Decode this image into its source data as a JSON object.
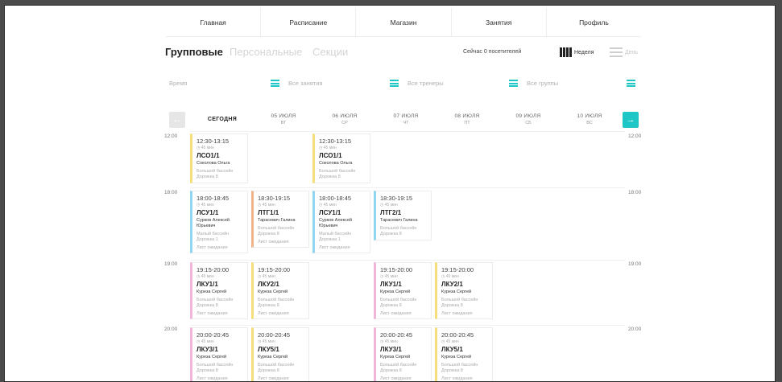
{
  "nav": [
    "Главная",
    "Расписание",
    "Магазин",
    "Занятия",
    "Профиль"
  ],
  "tabs": {
    "group": "Групповые",
    "personal": "Персональные",
    "sections": "Секции"
  },
  "visitors": "Сейчас 0 посетителей",
  "view": {
    "week": "Неделя",
    "day": "День"
  },
  "filters": [
    {
      "placeholder": "Время"
    },
    {
      "placeholder": "Все занятия"
    },
    {
      "placeholder": "Все тренеры"
    },
    {
      "placeholder": "Все группы"
    }
  ],
  "arrows": {
    "prev": "←",
    "next": "→"
  },
  "days": [
    {
      "d1": "СЕГОДНЯ",
      "d2": ""
    },
    {
      "d1": "05 ИЮЛЯ",
      "d2": "ВТ"
    },
    {
      "d1": "06 ИЮЛЯ",
      "d2": "СР"
    },
    {
      "d1": "07 ИЮЛЯ",
      "d2": "ЧТ"
    },
    {
      "d1": "08 ИЮЛЯ",
      "d2": "ПТ"
    },
    {
      "d1": "09 ИЮЛЯ",
      "d2": "СБ"
    },
    {
      "d1": "10 ИЮЛЯ",
      "d2": "ВС"
    }
  ],
  "hours": [
    "12:00",
    "18:00",
    "19:00",
    "20:00"
  ],
  "cards": [
    {
      "time": "12:30-13:15",
      "dur": "45 мин",
      "code": "ЛСО1/1",
      "coach": "Соколова Ольга",
      "loc": "Большой бассейн Дорожка 8",
      "wait": "",
      "color": "yellow"
    },
    {
      "time": "12:30-13:15",
      "dur": "45 мин",
      "code": "ЛСО1/1",
      "coach": "Соколова Ольга",
      "loc": "Большой бассейн Дорожка 8",
      "wait": "",
      "color": "yellow"
    },
    {
      "time": "18:00-18:45",
      "dur": "45 мин",
      "code": "ЛСУ1/1",
      "coach": "Сурков Алексей Юрьевич",
      "loc": "Малый бассейн Дорожка 1",
      "wait": "Лист ожидания",
      "color": "blue"
    },
    {
      "time": "18:30-19:15",
      "dur": "45 мин",
      "code": "ЛТГ1/1",
      "coach": "Тарасевич Галина",
      "loc": "Большой бассейн Дорожка 8",
      "wait": "Лист ожидания",
      "color": "orange"
    },
    {
      "time": "18:00-18:45",
      "dur": "45 мин",
      "code": "ЛСУ1/1",
      "coach": "Сурков Алексей Юрьевич",
      "loc": "Малый бассейн Дорожка 1",
      "wait": "Лист ожидания",
      "color": "blue"
    },
    {
      "time": "18:30-19:15",
      "dur": "45 мин",
      "code": "ЛТГ2/1",
      "coach": "Тарасевич Галина",
      "loc": "Большой бассейн Дорожка 8",
      "wait": "",
      "color": "blue"
    },
    {
      "time": "19:15-20:00",
      "dur": "45 мин",
      "code": "ЛКУ1/1",
      "coach": "Куреза Сергей",
      "loc": "Большой бассейн Дорожка 8",
      "wait": "Лист ожидания",
      "color": "pink"
    },
    {
      "time": "19:15-20:00",
      "dur": "45 мин",
      "code": "ЛКУ2/1",
      "coach": "Куреза Сергей",
      "loc": "Большой бассейн Дорожка 8",
      "wait": "Лист ожидания",
      "color": "yellow"
    },
    {
      "time": "19:15-20:00",
      "dur": "45 мин",
      "code": "ЛКУ1/1",
      "coach": "Куреза Сергей",
      "loc": "Большой бассейн Дорожка 8",
      "wait": "Лист ожидания",
      "color": "pink"
    },
    {
      "time": "19:15-20:00",
      "dur": "45 мин",
      "code": "ЛКУ2/1",
      "coach": "Куреза Сергей",
      "loc": "Большой бассейн Дорожка 8",
      "wait": "Лист ожидания",
      "color": "yellow"
    },
    {
      "time": "20:00-20:45",
      "dur": "45 мин",
      "code": "ЛКУ3/1",
      "coach": "Куреза Сергей",
      "loc": "Большой бассейн Дорожка 8",
      "wait": "Лист ожидания",
      "color": "pink"
    },
    {
      "time": "20:00-20:45",
      "dur": "45 мин",
      "code": "ЛКУ5/1",
      "coach": "Куреза Сергей",
      "loc": "Большой бассейн Дорожка 8",
      "wait": "Лист ожидания",
      "color": "yellow"
    },
    {
      "time": "20:00-20:45",
      "dur": "45 мин",
      "code": "ЛКУ3/1",
      "coach": "Куреза Сергей",
      "loc": "Большой бассейн Дорожка 8",
      "wait": "Лист ожидания",
      "color": "pink"
    },
    {
      "time": "20:00-20:45",
      "dur": "45 мин",
      "code": "ЛКУ5/1",
      "coach": "Куреза Сергей",
      "loc": "Большой бассейн Дорожка 8",
      "wait": "Лист ожидания",
      "color": "yellow"
    }
  ]
}
